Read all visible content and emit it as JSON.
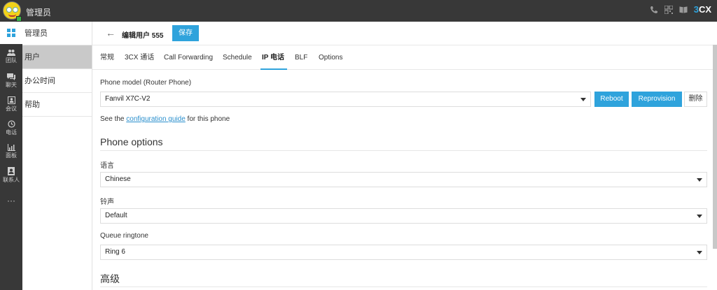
{
  "topbar": {
    "title": "管理员",
    "logo_prefix": "3",
    "logo_suffix": "CX",
    "icons": [
      "phone-icon",
      "qr-code-icon",
      "book-icon"
    ]
  },
  "rail": [
    {
      "name": "apps-icon",
      "label": ""
    },
    {
      "name": "team-icon",
      "label": "团队"
    },
    {
      "name": "chat-icon",
      "label": "聊天"
    },
    {
      "name": "meeting-icon",
      "label": "会议"
    },
    {
      "name": "call-history-icon",
      "label": "电话"
    },
    {
      "name": "panel-icon",
      "label": "面板"
    },
    {
      "name": "contacts-icon",
      "label": "联系人"
    },
    {
      "name": "more-icon",
      "label": "···"
    }
  ],
  "sidebar": {
    "items": [
      {
        "label": "管理员"
      },
      {
        "label": "用户"
      },
      {
        "label": "办公时间"
      },
      {
        "label": "帮助"
      }
    ]
  },
  "header": {
    "back_icon": "←",
    "title": "编辑用户  555",
    "save_label": "保存"
  },
  "tabs": [
    {
      "label": "常规"
    },
    {
      "label": "3CX 通话"
    },
    {
      "label": "Call Forwarding"
    },
    {
      "label": "Schedule"
    },
    {
      "label": "IP 电话"
    },
    {
      "label": "BLF"
    },
    {
      "label": "Options"
    }
  ],
  "phone_model": {
    "label": "Phone model (Router Phone)",
    "value": "Fanvil X7C-V2",
    "reboot_label": "Reboot",
    "reprovision_label": "Reprovision",
    "delete_label": "删除"
  },
  "hint": {
    "prefix": "See the ",
    "link": "configuration guide",
    "suffix": " for this phone"
  },
  "phone_options": {
    "title": "Phone options",
    "language_label": "语言",
    "language_value": "Chinese",
    "ringtone_label": "铃声",
    "ringtone_value": "Default",
    "queue_label": "Queue ringtone",
    "queue_value": "Ring 6"
  },
  "advanced": {
    "title": "高级"
  },
  "colors": {
    "accent": "#2fa3dc",
    "topbar": "#383838",
    "status": "#3bb54a"
  }
}
